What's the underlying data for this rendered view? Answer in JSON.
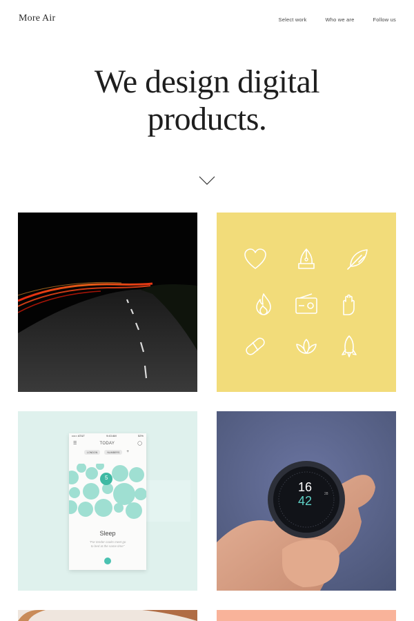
{
  "header": {
    "logo": "More Air",
    "nav": [
      "Select work",
      "Who we are",
      "Follow us"
    ]
  },
  "hero": {
    "line1": "We design digital",
    "line2": "products."
  },
  "tiles": {
    "t2_icons": [
      "heart-icon",
      "pen-nib-icon",
      "feather-icon",
      "flame-icon",
      "radio-icon",
      "hand-icon",
      "pill-icon",
      "lotus-icon",
      "rocket-icon"
    ],
    "phone": {
      "carrier": "••••○ AT&T",
      "time": "9:43 AM",
      "battery": "52%",
      "title": "TODAY",
      "chip1": "LONDON",
      "chip2": "NUMBERS",
      "badge": "5",
      "label": "Sleep",
      "quote_line1": "\"For tender cooks meet go",
      "quote_line2": "to bed at the same time\""
    },
    "watch": {
      "hours": "16",
      "minutes": "42",
      "side": "28"
    }
  },
  "colors": {
    "yellow": "#f2dc7a",
    "mint": "#dff1ed",
    "teal_bubble": "#9fdfd2",
    "slate": "#5b6588",
    "salmon": "#f9b39a"
  }
}
